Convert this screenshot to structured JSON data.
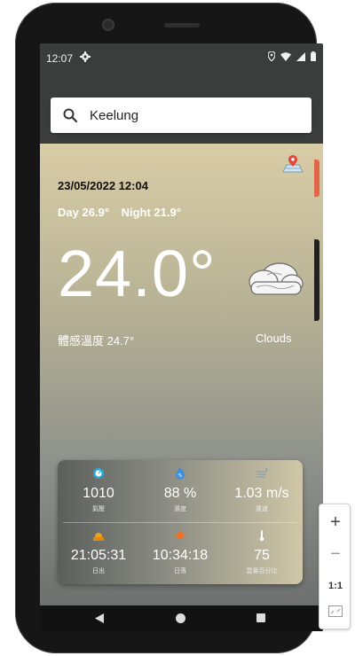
{
  "status_bar": {
    "time": "12:07",
    "icons": [
      "gear-icon",
      "location-icon",
      "wifi-icon",
      "signal-icon",
      "battery-icon"
    ]
  },
  "search": {
    "value": "Keelung",
    "icon": "search-icon"
  },
  "weather": {
    "datetime": "23/05/2022 12:04",
    "day_temp": "Day 26.9°",
    "night_temp": "Night 21.9°",
    "current_temp": "24.0°",
    "feels_like": "體感溫度 24.7°",
    "condition": "Clouds",
    "condition_icon": "cloud-icon",
    "map_icon": "map-pin-icon"
  },
  "stats": [
    {
      "icon": "pressure-icon",
      "value": "1010",
      "label": "氣壓"
    },
    {
      "icon": "humidity-icon",
      "value": "88 %",
      "label": "濕度"
    },
    {
      "icon": "wind-icon",
      "value": "1.03 m/s",
      "label": "風速"
    },
    {
      "icon": "sunrise-icon",
      "value": "21:05:31",
      "label": "日出"
    },
    {
      "icon": "sunset-icon",
      "value": "10:34:18",
      "label": "日落"
    },
    {
      "icon": "thermometer-icon",
      "value": "75",
      "label": "雲量百分比"
    }
  ],
  "zoom_controls": {
    "zoom_in": "+",
    "zoom_out": "−",
    "reset": "1:1"
  },
  "colors": {
    "panel_top": "#d9cda6",
    "panel_bottom": "#6d706e",
    "screen_bg": "#3b3d3c"
  }
}
